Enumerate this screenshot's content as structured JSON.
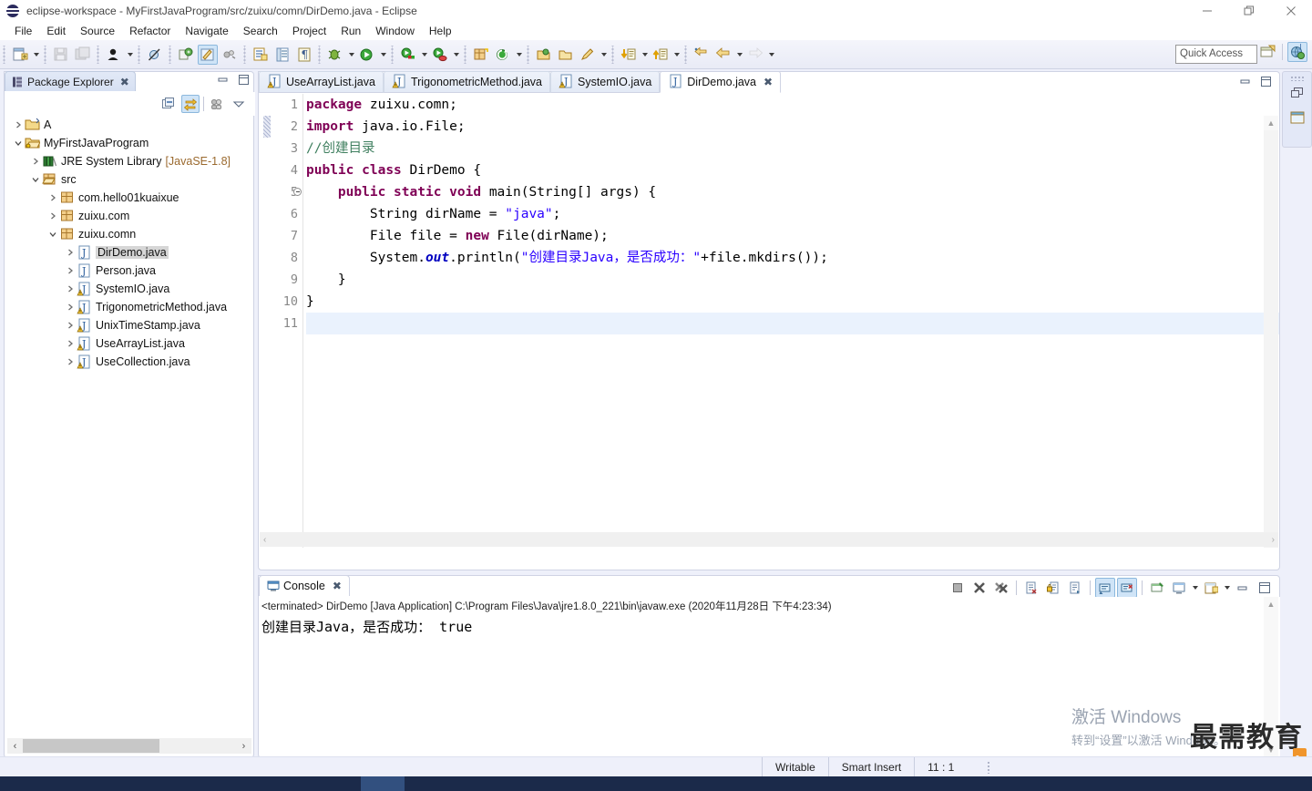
{
  "window": {
    "title": "eclipse-workspace - MyFirstJavaProgram/src/zuixu/comn/DirDemo.java - Eclipse",
    "icon": "eclipse-globe-icon",
    "controls": {
      "minimize": "—",
      "restore": "❐",
      "close": "✕"
    }
  },
  "menubar": {
    "items": [
      "File",
      "Edit",
      "Source",
      "Refactor",
      "Navigate",
      "Search",
      "Project",
      "Run",
      "Window",
      "Help"
    ]
  },
  "toolbar": {
    "quick_access_placeholder": "Quick Access",
    "groups": [
      {
        "buttons": [
          {
            "name": "new-wizard-icon",
            "glyph": "🗋",
            "color": "#f7f7ff",
            "kind": "newfile",
            "dropdown": true
          }
        ]
      },
      {
        "buttons": [
          {
            "name": "save-icon",
            "glyph": "💾",
            "kind": "save",
            "disabled": true
          },
          {
            "name": "save-all-icon",
            "glyph": "💾",
            "kind": "saveall",
            "disabled": true
          }
        ]
      },
      {
        "buttons": [
          {
            "name": "user-icon",
            "kind": "person",
            "dropdown": true
          }
        ]
      },
      {
        "buttons": [
          {
            "name": "skip-breakpoints-icon",
            "kind": "skipbp"
          }
        ]
      },
      {
        "buttons": [
          {
            "name": "run-last-tool-icon",
            "kind": "extern"
          },
          {
            "name": "marker-icon",
            "kind": "pen",
            "active": true
          },
          {
            "name": "toggle-mark-occurrences-icon",
            "kind": "occ"
          }
        ]
      },
      {
        "buttons": [
          {
            "name": "new-java-class-icon",
            "kind": "javaclass"
          },
          {
            "name": "open-type-icon",
            "kind": "opentype"
          },
          {
            "name": "show-whitespace-icon",
            "kind": "pilcrow"
          }
        ]
      },
      {
        "buttons": [
          {
            "name": "debug-icon",
            "kind": "debug",
            "dropdown": true
          },
          {
            "name": "run-icon",
            "kind": "run",
            "dropdown": true
          }
        ]
      },
      {
        "buttons": [
          {
            "name": "run-coverage-icon",
            "kind": "coverage",
            "dropdown": true
          },
          {
            "name": "profile-icon",
            "kind": "profile",
            "dropdown": true
          }
        ]
      },
      {
        "buttons": [
          {
            "name": "new-package-icon",
            "kind": "newpkg"
          },
          {
            "name": "refresh-icon",
            "kind": "refresh",
            "dropdown": true
          }
        ]
      },
      {
        "buttons": [
          {
            "name": "open-task-icon",
            "kind": "task1"
          },
          {
            "name": "open-folder-icon",
            "kind": "task2"
          },
          {
            "name": "search-icon",
            "kind": "searchpen",
            "dropdown": true
          }
        ]
      },
      {
        "buttons": [
          {
            "name": "next-annotation-icon",
            "kind": "down",
            "dropdown": true
          },
          {
            "name": "previous-annotation-icon",
            "kind": "up",
            "dropdown": true
          }
        ]
      },
      {
        "buttons": [
          {
            "name": "last-edit-location-icon",
            "kind": "lastedit"
          },
          {
            "name": "back-icon",
            "kind": "back",
            "dropdown": true
          },
          {
            "name": "forward-icon",
            "kind": "fwd",
            "dropdown": true,
            "disabled": true
          }
        ]
      }
    ],
    "perspective": [
      {
        "name": "open-perspective-icon"
      },
      {
        "name": "java-perspective-icon",
        "active": true
      }
    ]
  },
  "package_explorer": {
    "tab_label": "Package Explorer",
    "tab_close": "✖",
    "view_buttons": [
      {
        "name": "collapse-all-icon",
        "active": false
      },
      {
        "name": "link-with-editor-icon",
        "active": true
      },
      {
        "name": "focus-on-active-task-icon",
        "active": false
      },
      {
        "name": "view-menu-icon",
        "active": false
      }
    ],
    "tree": [
      {
        "indent": 0,
        "arrow": "collapsed",
        "icon": "project-closed-icon",
        "label": "A",
        "suffix": ""
      },
      {
        "indent": 0,
        "arrow": "expanded",
        "icon": "project-open-icon",
        "label": "MyFirstJavaProgram",
        "suffix": ""
      },
      {
        "indent": 1,
        "arrow": "collapsed",
        "icon": "library-icon",
        "label": "JRE System Library",
        "suffix": "[JavaSE-1.8]"
      },
      {
        "indent": 1,
        "arrow": "expanded",
        "icon": "source-folder-icon",
        "label": "src",
        "suffix": ""
      },
      {
        "indent": 2,
        "arrow": "collapsed",
        "icon": "package-icon",
        "label": "com.hello01kuaixue",
        "suffix": ""
      },
      {
        "indent": 2,
        "arrow": "collapsed",
        "icon": "package-icon",
        "label": "zuixu.com",
        "suffix": ""
      },
      {
        "indent": 2,
        "arrow": "expanded",
        "icon": "package-icon",
        "label": "zuixu.comn",
        "suffix": ""
      },
      {
        "indent": 3,
        "arrow": "collapsed",
        "icon": "java-file-icon",
        "label": "DirDemo.java",
        "suffix": "",
        "selected": true
      },
      {
        "indent": 3,
        "arrow": "collapsed",
        "icon": "java-file-icon",
        "label": "Person.java",
        "suffix": ""
      },
      {
        "indent": 3,
        "arrow": "collapsed",
        "icon": "java-file-warning-icon",
        "label": "SystemIO.java",
        "suffix": ""
      },
      {
        "indent": 3,
        "arrow": "collapsed",
        "icon": "java-file-warning-icon",
        "label": "TrigonometricMethod.java",
        "suffix": ""
      },
      {
        "indent": 3,
        "arrow": "collapsed",
        "icon": "java-file-warning-icon",
        "label": "UnixTimeStamp.java",
        "suffix": ""
      },
      {
        "indent": 3,
        "arrow": "collapsed",
        "icon": "java-file-warning-icon",
        "label": "UseArrayList.java",
        "suffix": ""
      },
      {
        "indent": 3,
        "arrow": "collapsed",
        "icon": "java-file-warning-icon",
        "label": "UseCollection.java",
        "suffix": ""
      }
    ],
    "scroll_left": "‹",
    "scroll_right": "›"
  },
  "editor": {
    "tabs": [
      {
        "label": "UseArrayList.java",
        "icon": "java-file-warning-icon",
        "active": false
      },
      {
        "label": "TrigonometricMethod.java",
        "icon": "java-file-warning-icon",
        "active": false
      },
      {
        "label": "SystemIO.java",
        "icon": "java-file-warning-icon",
        "active": false
      },
      {
        "label": "DirDemo.java",
        "icon": "java-file-icon",
        "active": true,
        "close": "✖"
      }
    ],
    "lines": [
      {
        "n": 1,
        "fold": false,
        "current": false
      },
      {
        "n": 2,
        "fold": false,
        "current": false
      },
      {
        "n": 3,
        "fold": false,
        "current": false
      },
      {
        "n": 4,
        "fold": false,
        "current": false
      },
      {
        "n": 5,
        "fold": true,
        "current": false
      },
      {
        "n": 6,
        "fold": false,
        "current": false
      },
      {
        "n": 7,
        "fold": false,
        "current": false
      },
      {
        "n": 8,
        "fold": false,
        "current": false
      },
      {
        "n": 9,
        "fold": false,
        "current": false
      },
      {
        "n": 10,
        "fold": false,
        "current": false
      },
      {
        "n": 11,
        "fold": false,
        "current": true
      }
    ],
    "code_text": [
      "package zuixu.comn;",
      "import java.io.File;",
      "//创建目录",
      "public class DirDemo {",
      "    public static void main(String[] args) {",
      "        String dirName = \"java\";",
      "        File file = new File(dirName);",
      "        System.out.println(\"创建目录Java，是否成功：\"+file.mkdirs());",
      "    }",
      "}",
      ""
    ],
    "scroll_up": "▲",
    "scroll_down": "▼",
    "hscroll_left": "‹",
    "hscroll_right": "›"
  },
  "console": {
    "tab_label": "Console",
    "tab_close": "✖",
    "meta_line": "<terminated> DirDemo [Java Application] C:\\Program Files\\Java\\jre1.8.0_221\\bin\\javaw.exe (2020年11月28日 下午4:23:34)",
    "output": "创建目录Java，是否成功： true",
    "toolbar_buttons": [
      {
        "name": "terminate-icon",
        "active": false
      },
      {
        "name": "remove-launch-icon",
        "active": false
      },
      {
        "name": "remove-all-terminated-icon",
        "active": false
      },
      {
        "name": "clear-console-icon",
        "active": false
      },
      {
        "name": "lock-scroll-icon",
        "active": false
      },
      {
        "name": "word-wrap-icon",
        "active": false
      },
      {
        "name": "show-console-on-output-icon",
        "active": true
      },
      {
        "name": "show-console-on-error-icon",
        "active": true
      },
      {
        "name": "pin-console-icon",
        "active": false
      },
      {
        "name": "display-selected-console-icon",
        "active": false,
        "dropdown": true
      },
      {
        "name": "open-console-icon",
        "active": false,
        "dropdown": true
      },
      {
        "name": "minimize-icon",
        "active": false
      },
      {
        "name": "maximize-icon",
        "active": false
      }
    ]
  },
  "right_shortcut_bar": {
    "buttons": [
      {
        "name": "restore-icon"
      },
      {
        "name": "package-explorer-shortcut-icon"
      }
    ]
  },
  "statusbar": {
    "writable": "Writable",
    "insert_mode": "Smart Insert",
    "position": "11 : 1"
  },
  "watermark": {
    "activate_title": "激活 Windows",
    "activate_sub": "转到“设置”以激活 Windows。",
    "brand": "最需教育"
  },
  "colors": {
    "accent_blue": "#cfe4f7",
    "panel_bg": "#eef0fa",
    "keyword": "#7f0055",
    "string": "#2a00ff",
    "comment": "#3f7f5f",
    "field": "#0000c0"
  }
}
